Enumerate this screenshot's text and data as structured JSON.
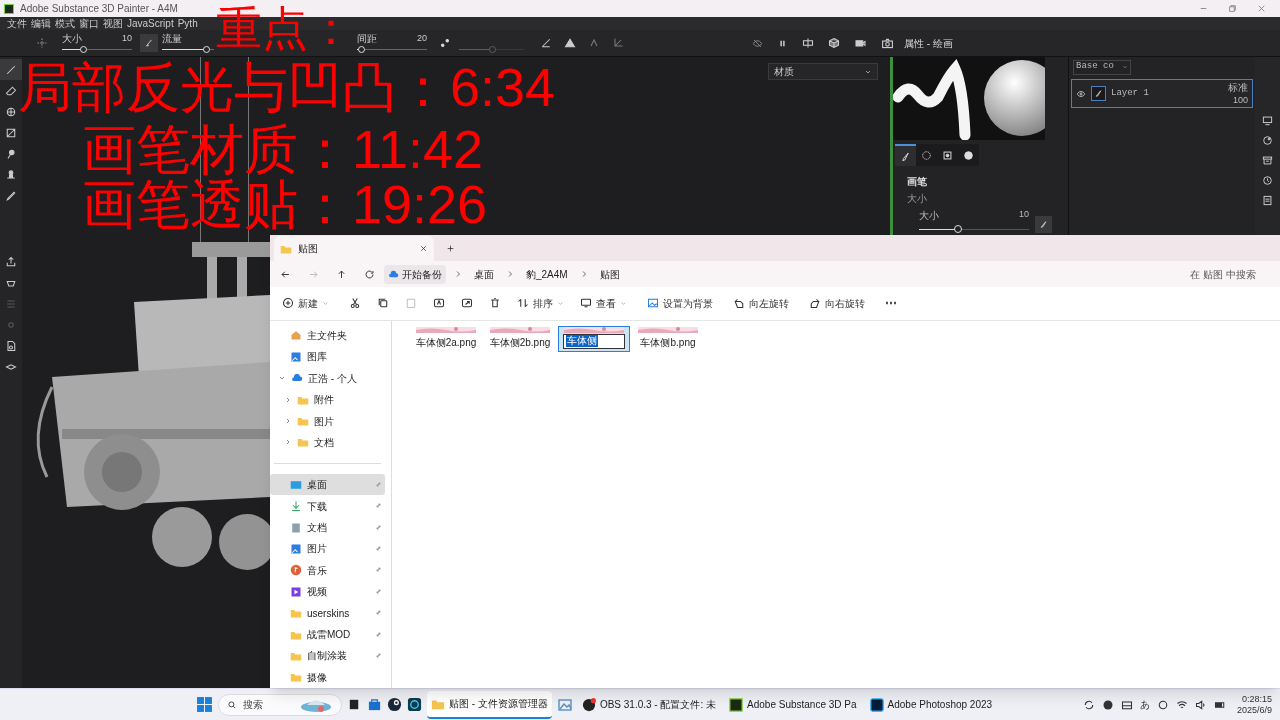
{
  "app": {
    "title": "Adobe Substance 3D Painter - A4M",
    "menu": [
      "文件",
      "编辑",
      "模式",
      "窗口",
      "视图",
      "JavaScript",
      "Pyth"
    ]
  },
  "tool_options": {
    "sliders": [
      {
        "label": "大小",
        "value": "10",
        "level": 0.3,
        "disabled": false
      },
      {
        "label": "流量",
        "level": 0.85,
        "disabled": false
      },
      {
        "label": "间距",
        "value": "20",
        "level": 0.05,
        "disabled": false
      },
      {
        "level": 0.5,
        "disabled": true
      }
    ]
  },
  "viewport": {
    "material_dropdown": "材质"
  },
  "properties": {
    "title": "属性 - 绘画",
    "tabs": [
      {
        "selected": true
      },
      {
        "selected": false
      },
      {
        "selected": false
      },
      {
        "selected": false
      }
    ],
    "section": "画笔",
    "group": "大小",
    "slider": {
      "label": "大小",
      "value": "10",
      "level": 0.35
    }
  },
  "layers": {
    "channel_dropdown": "Base co",
    "rows": [
      {
        "name": "Layer 1",
        "visible": true,
        "selected": true,
        "blend": "标准",
        "opacity": "100"
      }
    ]
  },
  "overlay": {
    "lines": [
      "重点：",
      "局部反光与凹凸：6:34",
      "画笔材质：11:42",
      "画笔透贴：19:26"
    ]
  },
  "explorer": {
    "tab": "贴图",
    "breadcrumb": [
      "开始备份",
      "桌面",
      "豹_2A4M",
      "贴图"
    ],
    "search_placeholder": "在 贴图 中搜索",
    "commands": [
      {
        "label": "新建",
        "dropdown": true,
        "disabled": false
      },
      {
        "disabled": false
      },
      {
        "disabled": false
      },
      {
        "disabled": true
      },
      {
        "disabled": false
      },
      {
        "disabled": false
      },
      {
        "disabled": false
      },
      {
        "label": "排序",
        "dropdown": true,
        "disabled": false
      },
      {
        "label": "查看",
        "dropdown": true,
        "disabled": false
      },
      {
        "label": "设置为背景",
        "disabled": false
      },
      {
        "label": "向左旋转",
        "disabled": false
      },
      {
        "label": "向右旋转",
        "disabled": false
      },
      {
        "label": "⋯",
        "disabled": false
      }
    ],
    "nav": [
      {
        "label": "主文件夹",
        "selected": false
      },
      {
        "label": "图库",
        "selected": false
      },
      {
        "label": "正浩 - 个人",
        "selected": false,
        "expanded": true,
        "children": [
          {
            "label": "附件",
            "selected": false,
            "expanded": false
          },
          {
            "label": "图片",
            "selected": false,
            "expanded": false
          },
          {
            "label": "文档",
            "selected": false,
            "expanded": false
          }
        ]
      }
    ],
    "pinned": [
      {
        "label": "桌面",
        "selected": true,
        "pinned": true
      },
      {
        "label": "下载",
        "selected": false,
        "pinned": true
      },
      {
        "label": "文档",
        "selected": false,
        "pinned": true
      },
      {
        "label": "图片",
        "selected": false,
        "pinned": true
      },
      {
        "label": "音乐",
        "selected": false,
        "pinned": true
      },
      {
        "label": "视频",
        "selected": false,
        "pinned": true
      },
      {
        "label": "userskins",
        "selected": false,
        "pinned": true
      },
      {
        "label": "战雷MOD",
        "selected": false,
        "pinned": true
      },
      {
        "label": "自制涂装",
        "selected": false,
        "pinned": true
      },
      {
        "label": "摄像",
        "selected": false,
        "pinned": false
      }
    ],
    "files": [
      {
        "name": "车体侧2a.png",
        "selected": false,
        "renaming": false
      },
      {
        "name": "车体侧2b.png",
        "selected": false,
        "renaming": false
      },
      {
        "name": "车体侧",
        "selected": true,
        "renaming": true
      },
      {
        "name": "车体侧b.png",
        "selected": false,
        "renaming": false
      }
    ]
  },
  "taskbar": {
    "search": "搜索",
    "apps": [
      {
        "label": "贴图 - 文件资源管理器",
        "active": true
      },
      {
        "label": "OBS 31.0.3 - 配置文件: 未",
        "active": false
      },
      {
        "label": "Adobe Substance 3D Pa",
        "active": false
      },
      {
        "label": "Adobe Photoshop 2023",
        "active": false
      }
    ],
    "ime": "あ",
    "time": "0:28:15",
    "date": "2025/6/9"
  }
}
